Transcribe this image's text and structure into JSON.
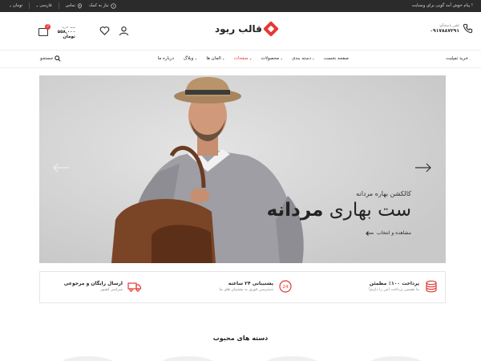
{
  "topbar": {
    "welcome": "پیام خوش آمد گویی برای وبسایت !",
    "language": "فارسی",
    "currency": "تومان",
    "contact": "تماس",
    "help": "نیاز به کمک"
  },
  "header": {
    "brand": "قالب ریود",
    "phone_label": "تلفن پاسخگو:",
    "phone_number": "۰۹۱۷۸۸۷۲۹۱",
    "cart_label": "سبد خرید",
    "cart_amount": "۵۵۸,۰۰۰ تومان",
    "cart_count": "2"
  },
  "nav": {
    "buy_label": "خرید تمپلیت",
    "search_label": "جستجو",
    "items": [
      {
        "label": "صفحه نخست"
      },
      {
        "label": "دسته بندی"
      },
      {
        "label": "محصولات"
      },
      {
        "label": "صفحات"
      },
      {
        "label": "المان ها"
      },
      {
        "label": "وبلاگ"
      },
      {
        "label": "درباره ما"
      }
    ]
  },
  "hero": {
    "subtitle": "کالکشن بهاره مردانه",
    "title_light": "ست بهاری",
    "title_bold": "مردانه",
    "cta": "مشاهده و انتخاب"
  },
  "features": [
    {
      "title": "پرداخت ۱۰۰٪ مطمئن",
      "subtitle": "ما تضمین پرداخت امن را داریم!",
      "icon": "coins-icon"
    },
    {
      "title": "پشتیبانی ۲۴ ساعته",
      "subtitle": "دسترسی فوری به پشتیبان های ما",
      "icon": "support-24-icon"
    },
    {
      "title": "ارسال رایگان و مرجوعی",
      "subtitle": "سراسر کشور",
      "icon": "truck-icon"
    }
  ],
  "section": {
    "title": "دسته های محبوب"
  },
  "colors": {
    "accent": "#e53935",
    "topbar": "#2b2b2b",
    "hero_bg": "#d2d2d2"
  }
}
